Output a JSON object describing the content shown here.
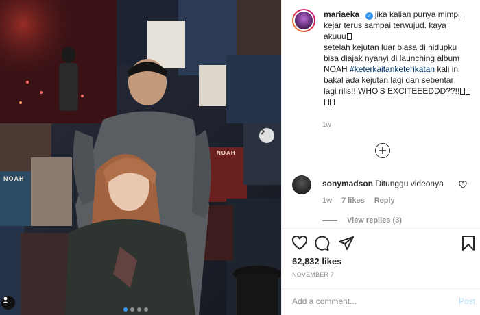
{
  "post": {
    "author": {
      "username": "mariaeka_",
      "verified_icon": "verified-badge-icon"
    },
    "caption": {
      "line1": "jika kalian punya mimpi,",
      "line2": "kejar terus sampai terwujud. kaya",
      "line3": "akuuu",
      "line4": "setelah kejutan luar biasa di hidupku",
      "line5": "bisa diajak nyanyi di launching album",
      "line6_pre": "NOAH ",
      "hashtag": "#keterkaitanketerikatan",
      "line6_post": " kali ini",
      "line7": "bakal ada kejutan lagi dan sebentar",
      "line8": "lagi rilis!! WHO'S EXCITEEEDDD??!!"
    },
    "age": "1w",
    "photo": {
      "poster_label": "NOAH",
      "carousel_dots": 4,
      "active_dot": 0
    }
  },
  "comments": [
    {
      "username": "sonymadson",
      "text": "Ditunggu videonya",
      "age": "1w",
      "likes": "7 likes",
      "reply_label": "Reply",
      "view_replies": "View replies (3)"
    }
  ],
  "stats": {
    "likes": "62,832 likes",
    "date": "NOVEMBER 7"
  },
  "add_comment": {
    "placeholder": "Add a comment...",
    "post_label": "Post"
  },
  "colors": {
    "link": "#00376b",
    "accent": "#3897f0",
    "post_disabled": "#b2dffc"
  }
}
